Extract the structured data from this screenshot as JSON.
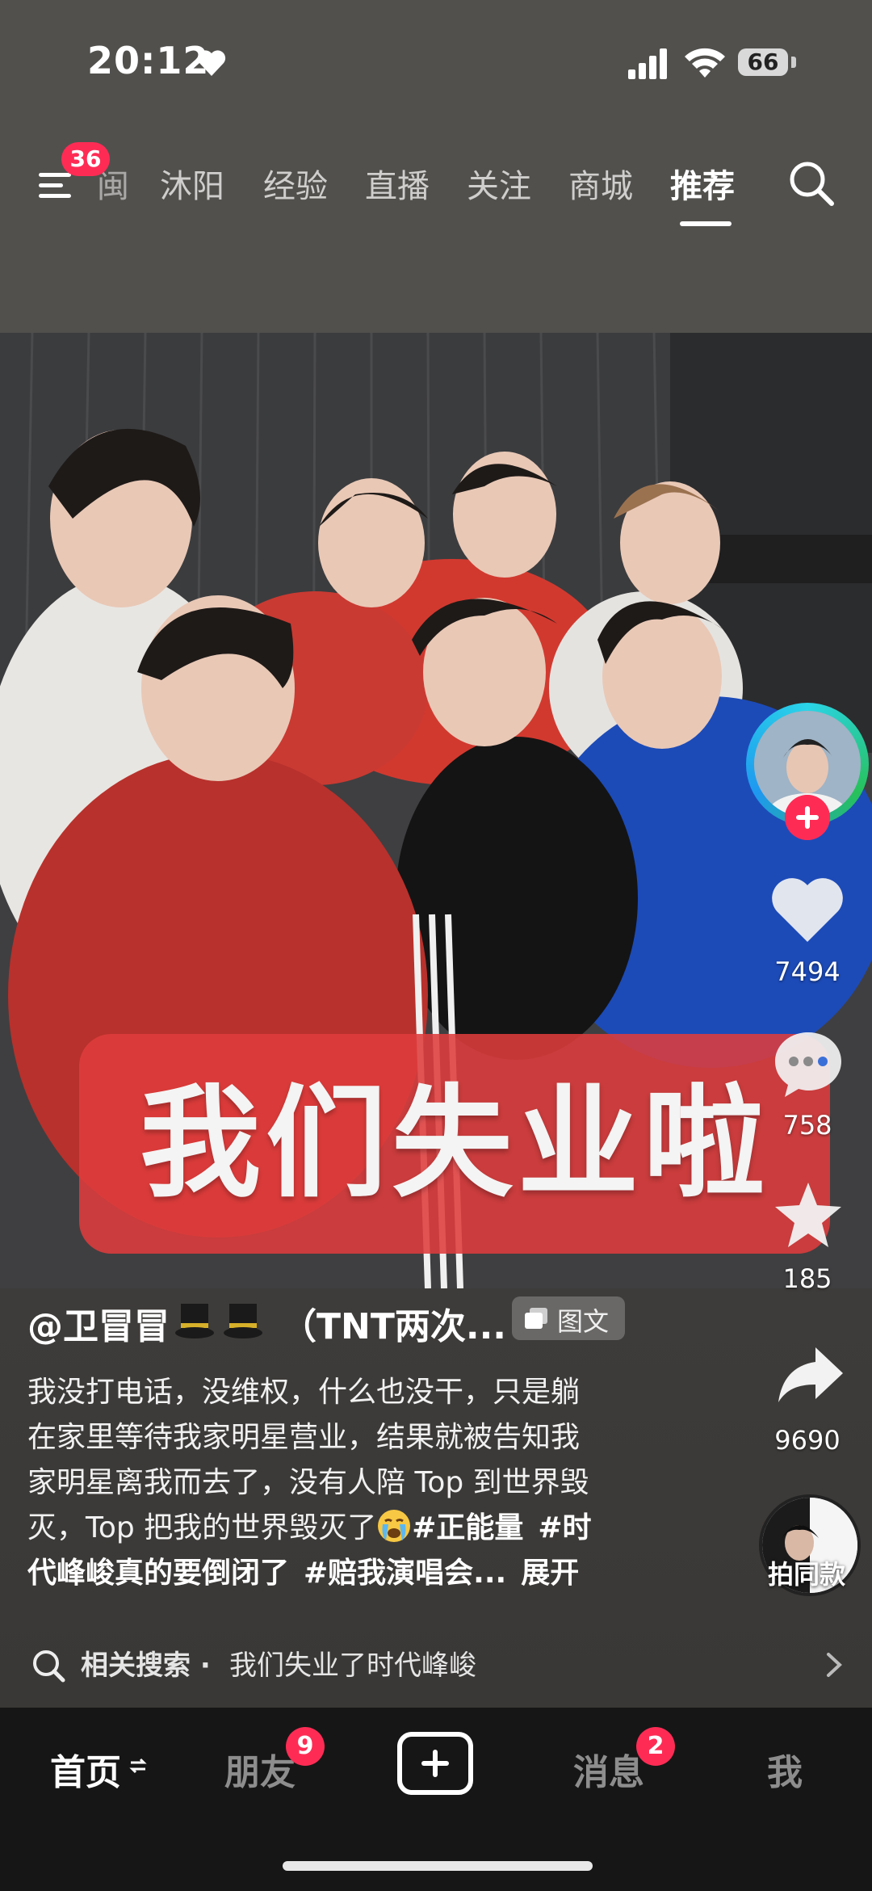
{
  "status_bar": {
    "time": "20:12",
    "battery": "66"
  },
  "nav": {
    "menu_badge": "36",
    "tabs": [
      {
        "label": "沐阳"
      },
      {
        "label": "经验"
      },
      {
        "label": "直播"
      },
      {
        "label": "关注"
      },
      {
        "label": "商城"
      },
      {
        "label": "推荐"
      }
    ],
    "partial_tab": "闽",
    "active_tab": "推荐"
  },
  "post": {
    "overlay_text": "我们失业啦",
    "author": "@卫冒冒",
    "author_suffix": "（TNT两次...",
    "badge": "图文",
    "description_lines": [
      "我没打电话，没维权，什么也没干，只是躺",
      "在家里等待我家明星营业，结果就被告知我",
      "家明星离我而去了，没有人陪 Top 到世界毁"
    ],
    "desc_line4_text": "灭，Top 把我的世界毁灭了",
    "tag1": "#正能量",
    "tag2_start": "#时",
    "tag2_end": "代峰峻真的要倒闭了",
    "tag3": "#赔我演唱会...",
    "expand": "展开"
  },
  "rail": {
    "likes": "7494",
    "comments": "758",
    "favorites": "185",
    "shares": "9690",
    "music_label": "拍同款"
  },
  "related": {
    "label": "相关搜索",
    "separator": "·",
    "query": "我们失业了时代峰峻"
  },
  "bottom_nav": {
    "home": "首页",
    "friends": "朋友",
    "friends_badge": "9",
    "messages": "消息",
    "messages_badge": "2",
    "me": "我"
  },
  "colors": {
    "accent": "#fe2c55",
    "banner": "#de3c3c",
    "bottom_bar": "#161616"
  }
}
